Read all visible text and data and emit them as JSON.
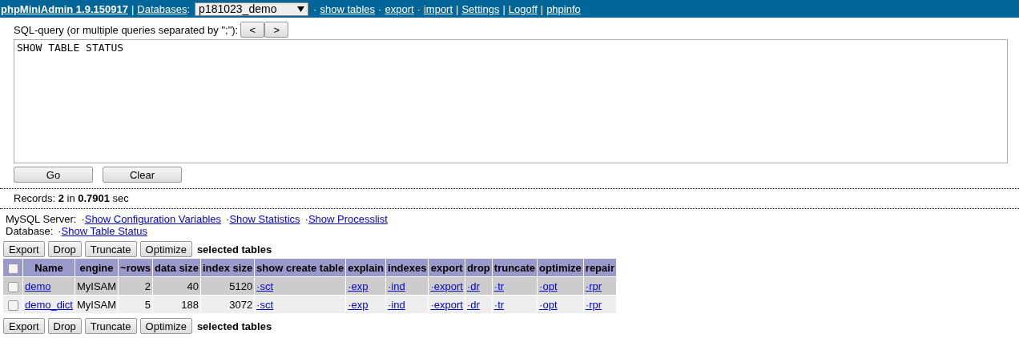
{
  "header": {
    "app_link": "phpMiniAdmin 1.9.150917",
    "separator": "|",
    "databases_link": "Databases",
    "colon": ":",
    "database_select": "p181023_demo",
    "nav": [
      {
        "sep": "·",
        "label": "show tables"
      },
      {
        "sep": "·",
        "label": "export"
      },
      {
        "sep": "·",
        "label": "import"
      },
      {
        "sep": "|",
        "label": "Settings"
      },
      {
        "sep": "|",
        "label": "Logoff"
      },
      {
        "sep": "|",
        "label": "phpinfo"
      }
    ]
  },
  "query": {
    "label": "SQL-query (or multiple queries separated by \";\"):",
    "history_buttons": [
      "<",
      ">"
    ],
    "value": "SHOW TABLE STATUS",
    "buttons": [
      "Go",
      "Clear"
    ]
  },
  "records": {
    "text": "Records: **2** in **0.7901** sec"
  },
  "server_links": {
    "label": "MySQL Server:",
    "links": [
      {
        "bullet": "·",
        "label": "Show Configuration Variables"
      },
      {
        "bullet": "·",
        "label": "Show Statistics"
      },
      {
        "bullet": "·",
        "label": "Show Processlist"
      }
    ]
  },
  "database_links": {
    "label": "Database:",
    "links": [
      {
        "bullet": "·",
        "label": "Show Table Status"
      }
    ]
  },
  "actions": {
    "buttons": [
      "Export",
      "Drop",
      "Truncate",
      "Optimize"
    ],
    "label": "selected tables"
  },
  "table": {
    "select_all_checked": false,
    "columns": [
      "Name",
      "engine",
      "~rows",
      "data size",
      "index size",
      "show create table",
      "explain",
      "indexes",
      "export",
      "drop",
      "truncate",
      "optimize",
      "repair"
    ],
    "rows": [
      {
        "checked": false,
        "cells": [
          "demo",
          "MyISAM",
          "2",
          "40",
          "5120",
          "·sct",
          "·exp",
          "·ind",
          "·export",
          "·dr",
          "·tr",
          "·opt",
          "·rpr"
        ]
      },
      {
        "checked": false,
        "cells": [
          "demo_dict",
          "MyISAM",
          "5",
          "188",
          "3072",
          "·sct",
          "·exp",
          "·ind",
          "·export",
          "·dr",
          "·tr",
          "·opt",
          "·rpr"
        ]
      }
    ]
  },
  "actions_bottom": {
    "buttons": [
      "Export",
      "Drop",
      "Truncate",
      "Optimize"
    ],
    "label": "selected tables"
  }
}
